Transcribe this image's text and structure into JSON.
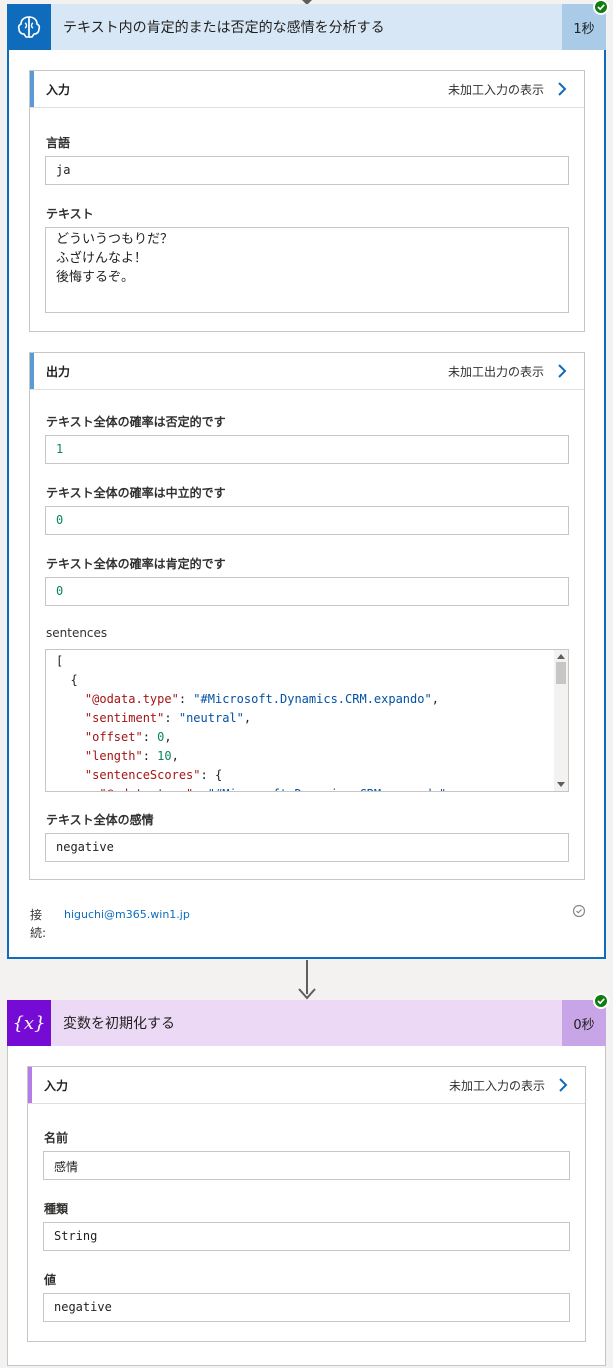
{
  "action1": {
    "title": "テキスト内の肯定的または否定的な感情を分析する",
    "duration": "1秒",
    "inputs": {
      "section_title": "入力",
      "raw_link": "未加工入力の表示",
      "language_label": "言語",
      "language_value": "ja",
      "text_label": "テキスト",
      "text_value": "どういうつもりだ？\nふざけんなよ！\n後悔するぞ。"
    },
    "outputs": {
      "section_title": "出力",
      "raw_link": "未加工出力の表示",
      "negative_label": "テキスト全体の確率は否定的です",
      "negative_value": "1",
      "neutral_label": "テキスト全体の確率は中立的です",
      "neutral_value": "0",
      "positive_label": "テキスト全体の確率は肯定的です",
      "positive_value": "0",
      "sentences_label": "sentences",
      "sentences_lines": [
        "[",
        "  {",
        "    \"@odata.type\": \"#Microsoft.Dynamics.CRM.expando\",",
        "    \"sentiment\": \"neutral\",",
        "    \"offset\": 0,",
        "    \"length\": 10,",
        "    \"sentenceScores\": {",
        "      \"@odata.type\": \"#Microsoft.Dynamics.CRM.expando\","
      ],
      "sentiment_label": "テキスト全体の感情",
      "sentiment_value": "negative"
    },
    "connection": {
      "label": "接続:",
      "account": "higuchi@m365.win1.jp"
    }
  },
  "action2": {
    "title": "変数を初期化する",
    "duration": "0秒",
    "inputs": {
      "section_title": "入力",
      "raw_link": "未加工入力の表示",
      "name_label": "名前",
      "name_value": "感情",
      "type_label": "種類",
      "type_value": "String",
      "value_label": "値",
      "value_value": "negative"
    }
  },
  "colors": {
    "ai_brand": "#0f6cbd",
    "variable_brand": "#770bd6",
    "success": "#107c10"
  }
}
